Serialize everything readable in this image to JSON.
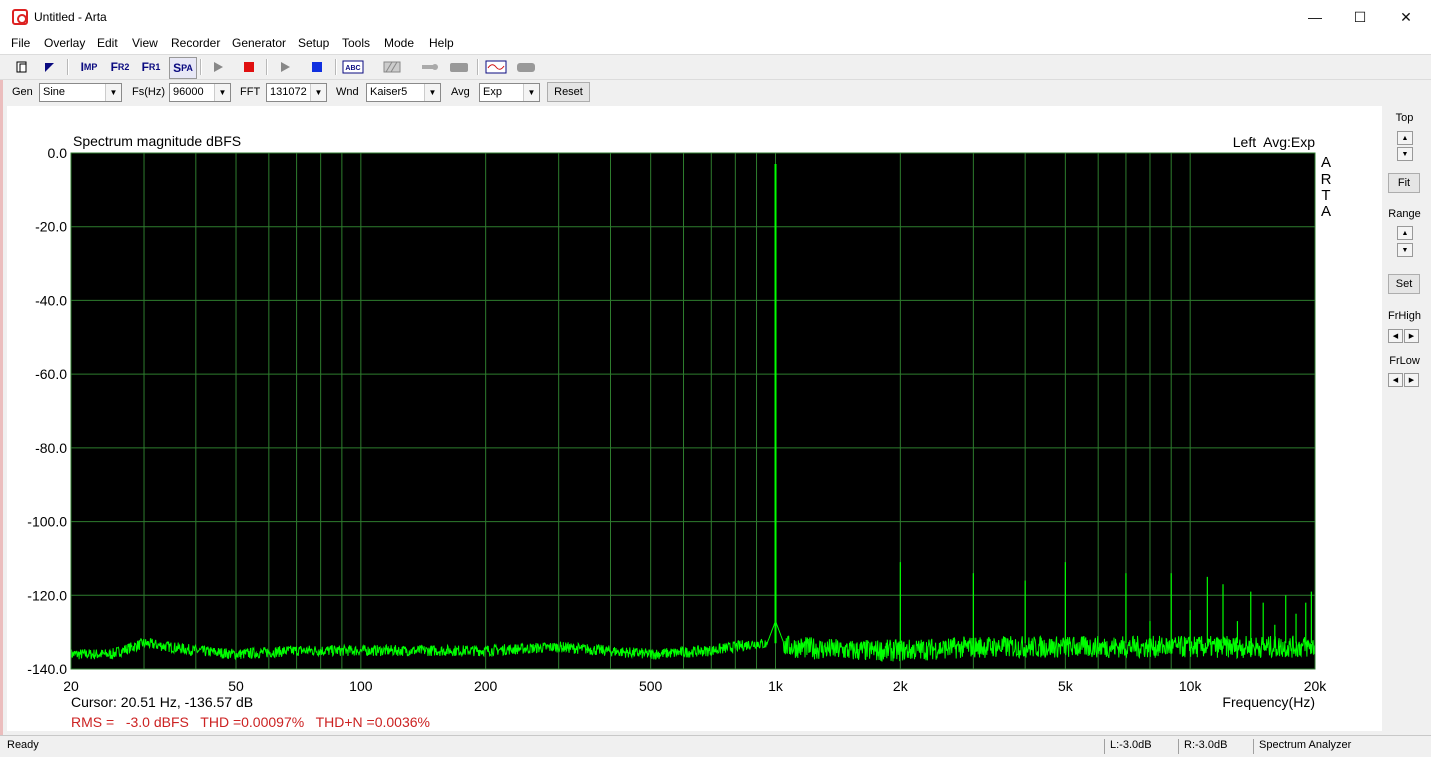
{
  "window": {
    "title": "Untitled - Arta",
    "controls": [
      "minimize",
      "maximize",
      "close"
    ]
  },
  "menu": [
    "File",
    "Overlay",
    "Edit",
    "View",
    "Recorder",
    "Generator",
    "Setup",
    "Tools",
    "Mode",
    "Help"
  ],
  "toolbar": {
    "buttons": [
      {
        "name": "new-icon"
      },
      {
        "name": "open-icon"
      },
      {
        "name": "imp-button",
        "label": "IMP"
      },
      {
        "name": "fr2-button",
        "label": "FR2"
      },
      {
        "name": "fr1-button",
        "label": "FR1"
      },
      {
        "name": "spa-button",
        "label": "SPA"
      },
      {
        "name": "play-icon"
      },
      {
        "name": "stop-icon"
      },
      {
        "name": "play2-icon"
      },
      {
        "name": "stop2-icon"
      },
      {
        "name": "abc-icon"
      },
      {
        "name": "grid-icon"
      },
      {
        "name": "probe-icon"
      },
      {
        "name": "gray-icon"
      },
      {
        "name": "wave-icon"
      },
      {
        "name": "gray2-icon"
      }
    ]
  },
  "params": {
    "gen_label": "Gen",
    "gen_value": "Sine",
    "fs_label": "Fs(Hz)",
    "fs_value": "96000",
    "fft_label": "FFT",
    "fft_value": "131072",
    "wnd_label": "Wnd",
    "wnd_value": "Kaiser5",
    "avg_label": "Avg",
    "avg_value": "Exp",
    "reset_label": "Reset"
  },
  "right_panel": {
    "top_label": "Top",
    "fit_label": "Fit",
    "range_label": "Range",
    "set_label": "Set",
    "frhigh_label": "FrHigh",
    "frlow_label": "FrLow"
  },
  "plot": {
    "title": "Spectrum magnitude dBFS",
    "channel_info": "Left  Avg:Exp",
    "watermark": [
      "A",
      "R",
      "T",
      "A"
    ],
    "cursor": "Cursor: 20.51 Hz, -136.57 dB",
    "metrics": "RMS =   -3.0 dBFS   THD =0.00097%   THD+N =0.0036%",
    "xlabel": "Frequency(Hz)",
    "trace_color": "#00ff00",
    "grid_color": "#2e7d2e",
    "background": "#000000",
    "metrics_color": "#cc2222"
  },
  "chart_data": {
    "type": "line",
    "title": "Spectrum magnitude dBFS",
    "xlabel": "Frequency(Hz)",
    "ylabel": "",
    "x_scale": "log",
    "xlim": [
      20,
      20000
    ],
    "ylim": [
      -140,
      0
    ],
    "xticks": [
      {
        "v": 20,
        "l": "20"
      },
      {
        "v": 50,
        "l": "50"
      },
      {
        "v": 100,
        "l": "100"
      },
      {
        "v": 200,
        "l": "200"
      },
      {
        "v": 500,
        "l": "500"
      },
      {
        "v": 1000,
        "l": "1k"
      },
      {
        "v": 2000,
        "l": "2k"
      },
      {
        "v": 5000,
        "l": "5k"
      },
      {
        "v": 10000,
        "l": "10k"
      },
      {
        "v": 20000,
        "l": "20k"
      }
    ],
    "yticks": [
      "0.0",
      "-20.0",
      "-40.0",
      "-60.0",
      "-80.0",
      "-100.0",
      "-120.0",
      "-140.0"
    ],
    "grid": true,
    "series": [
      {
        "color": "#00ff00",
        "noise_floor": [
          [
            20,
            -136
          ],
          [
            25,
            -136
          ],
          [
            30,
            -133
          ],
          [
            40,
            -135
          ],
          [
            50,
            -136
          ],
          [
            70,
            -135
          ],
          [
            100,
            -135
          ],
          [
            150,
            -135
          ],
          [
            200,
            -135
          ],
          [
            300,
            -134
          ],
          [
            500,
            -136
          ],
          [
            700,
            -135
          ],
          [
            900,
            -133
          ],
          [
            1000,
            -3
          ],
          [
            1100,
            -134
          ],
          [
            1500,
            -135
          ],
          [
            2000,
            -135
          ],
          [
            3000,
            -134
          ],
          [
            5000,
            -134
          ],
          [
            10000,
            -134
          ],
          [
            20000,
            -134
          ]
        ],
        "peaks": [
          {
            "x": 1000,
            "y": -3
          },
          {
            "x": 2000,
            "y": -111
          },
          {
            "x": 3000,
            "y": -114
          },
          {
            "x": 4000,
            "y": -116
          },
          {
            "x": 5000,
            "y": -111
          },
          {
            "x": 7000,
            "y": -114
          },
          {
            "x": 8000,
            "y": -127
          },
          {
            "x": 9000,
            "y": -114
          },
          {
            "x": 10000,
            "y": -124
          },
          {
            "x": 11000,
            "y": -115
          },
          {
            "x": 12000,
            "y": -117
          },
          {
            "x": 13000,
            "y": -127
          },
          {
            "x": 14000,
            "y": -119
          },
          {
            "x": 15000,
            "y": -122
          },
          {
            "x": 16000,
            "y": -128
          },
          {
            "x": 17000,
            "y": -120
          },
          {
            "x": 18000,
            "y": -125
          },
          {
            "x": 19000,
            "y": -122
          },
          {
            "x": 19600,
            "y": -119
          }
        ]
      }
    ]
  },
  "status": {
    "ready": "Ready",
    "left_level": "L:-3.0dB",
    "right_level": "R:-3.0dB",
    "mode": "Spectrum Analyzer"
  }
}
